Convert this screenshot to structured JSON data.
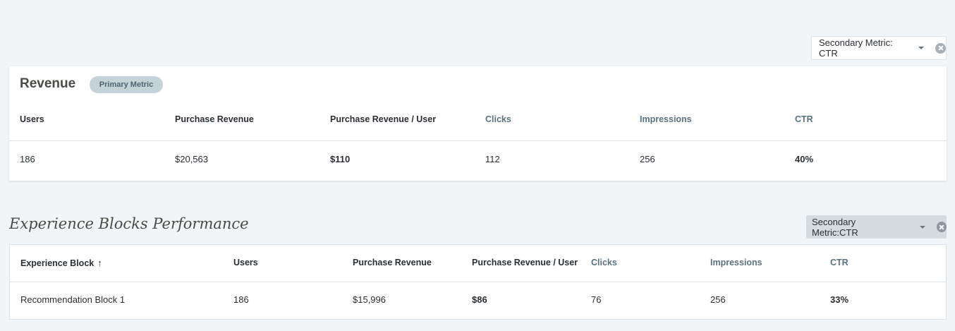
{
  "top_selector": {
    "label": "Secondary Metric: CTR"
  },
  "revenue": {
    "title": "Revenue",
    "badge": "Primary Metric",
    "headers": [
      "Users",
      "Purchase Revenue",
      "Purchase Revenue / User",
      "Clicks",
      "Impressions",
      "CTR"
    ],
    "values": [
      "186",
      "$20,563",
      "$110",
      "112",
      "256",
      "40%"
    ]
  },
  "experience_blocks": {
    "title": "Experience Blocks Performance",
    "selector_label": "Secondary Metric:CTR",
    "headers": [
      "Experience Block",
      "Users",
      "Purchase Revenue",
      "Purchase Revenue / User",
      "Clicks",
      "Impressions",
      "CTR"
    ],
    "sort_icon": "↑",
    "rows": [
      [
        "Recommendation Block 1",
        "186",
        "$15,996",
        "$86",
        "76",
        "256",
        "33%"
      ]
    ]
  },
  "colors": {
    "secondary_header": "#5a7280",
    "badge_bg": "#c4d3d8"
  }
}
